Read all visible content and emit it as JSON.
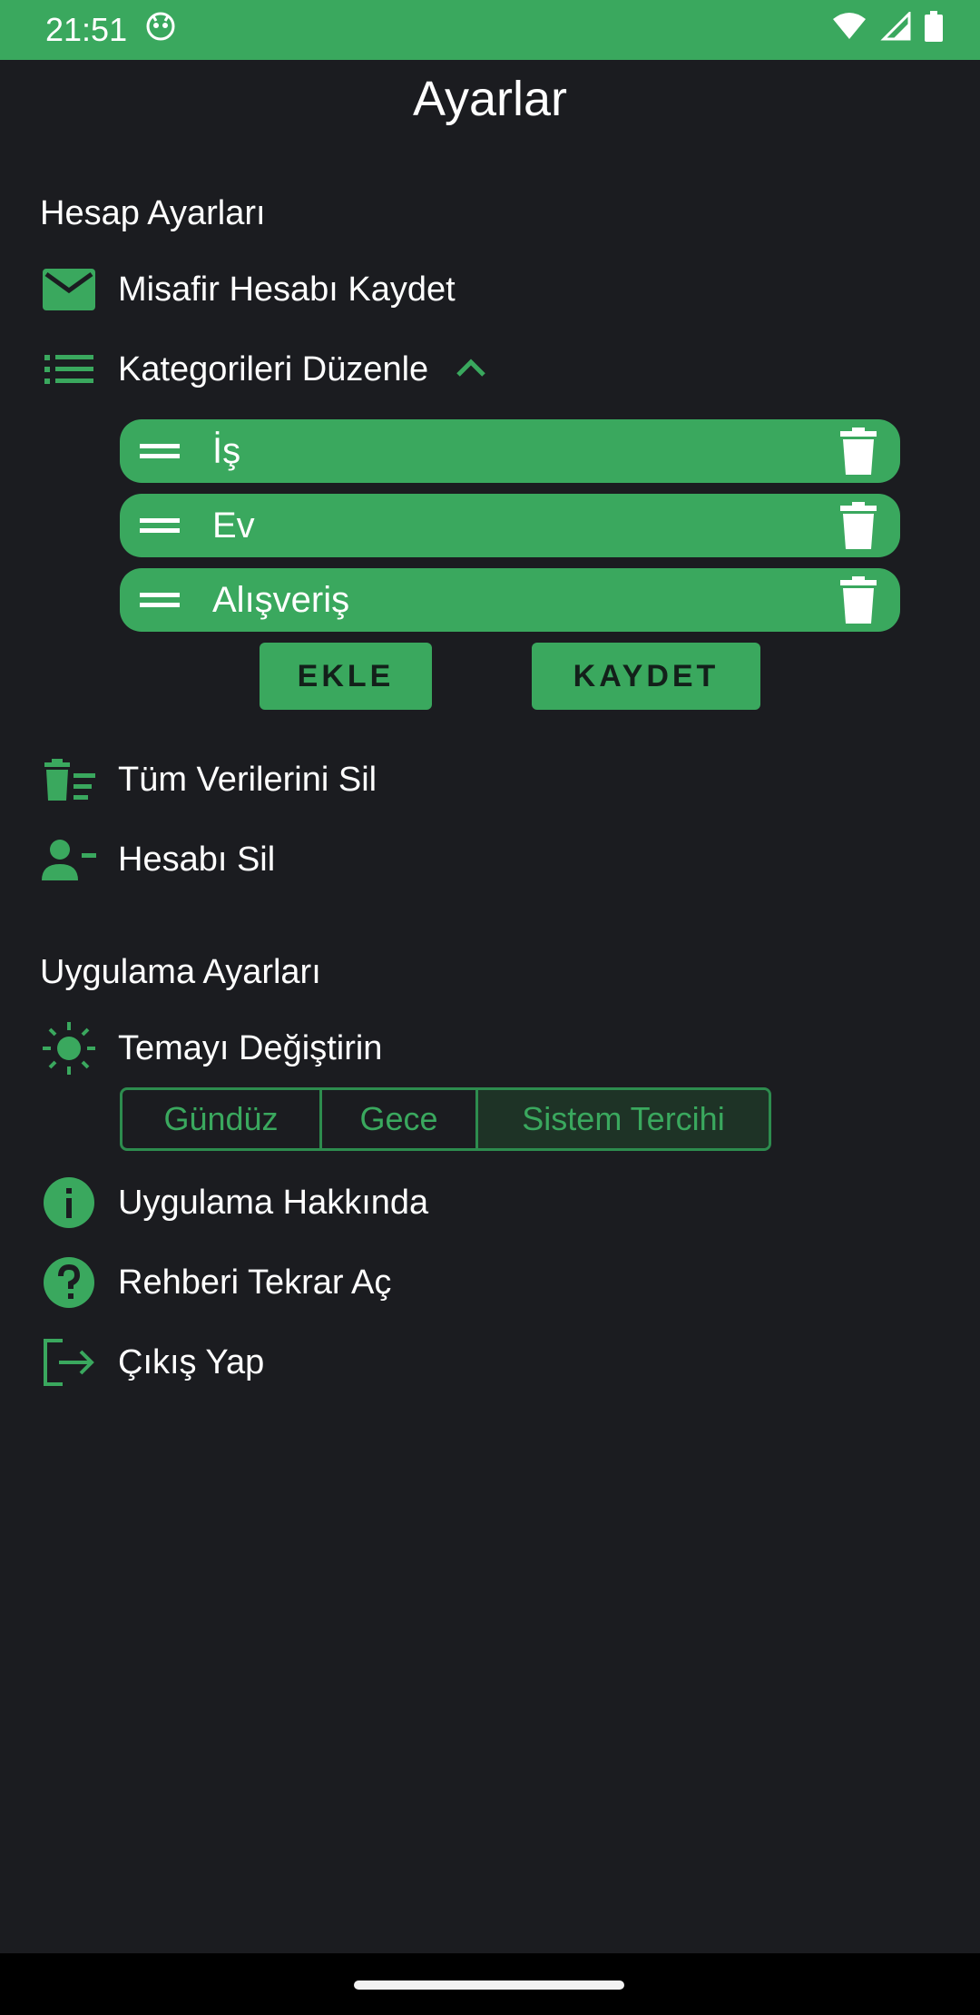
{
  "status_bar": {
    "time": "21:51"
  },
  "header": {
    "title": "Ayarlar"
  },
  "account_section": {
    "title": "Hesap Ayarları",
    "save_guest": "Misafir Hesabı Kaydet",
    "edit_categories": "Kategorileri Düzenle",
    "categories": [
      "İş",
      "Ev",
      "Alışveriş"
    ],
    "add_label": "EKLE",
    "save_label": "KAYDET",
    "delete_all_data": "Tüm Verilerini Sil",
    "delete_account": "Hesabı Sil"
  },
  "app_section": {
    "title": "Uygulama Ayarları",
    "change_theme": "Temayı Değiştirin",
    "theme_options": [
      "Gündüz",
      "Gece",
      "Sistem Tercihi"
    ],
    "theme_selected": "Sistem Tercihi",
    "about": "Uygulama Hakkında",
    "reopen_guide": "Rehberi Tekrar Aç",
    "logout": "Çıkış Yap"
  },
  "colors": {
    "accent": "#3aa85e",
    "background": "#1b1c20",
    "status_bar": "#3aa85e"
  }
}
